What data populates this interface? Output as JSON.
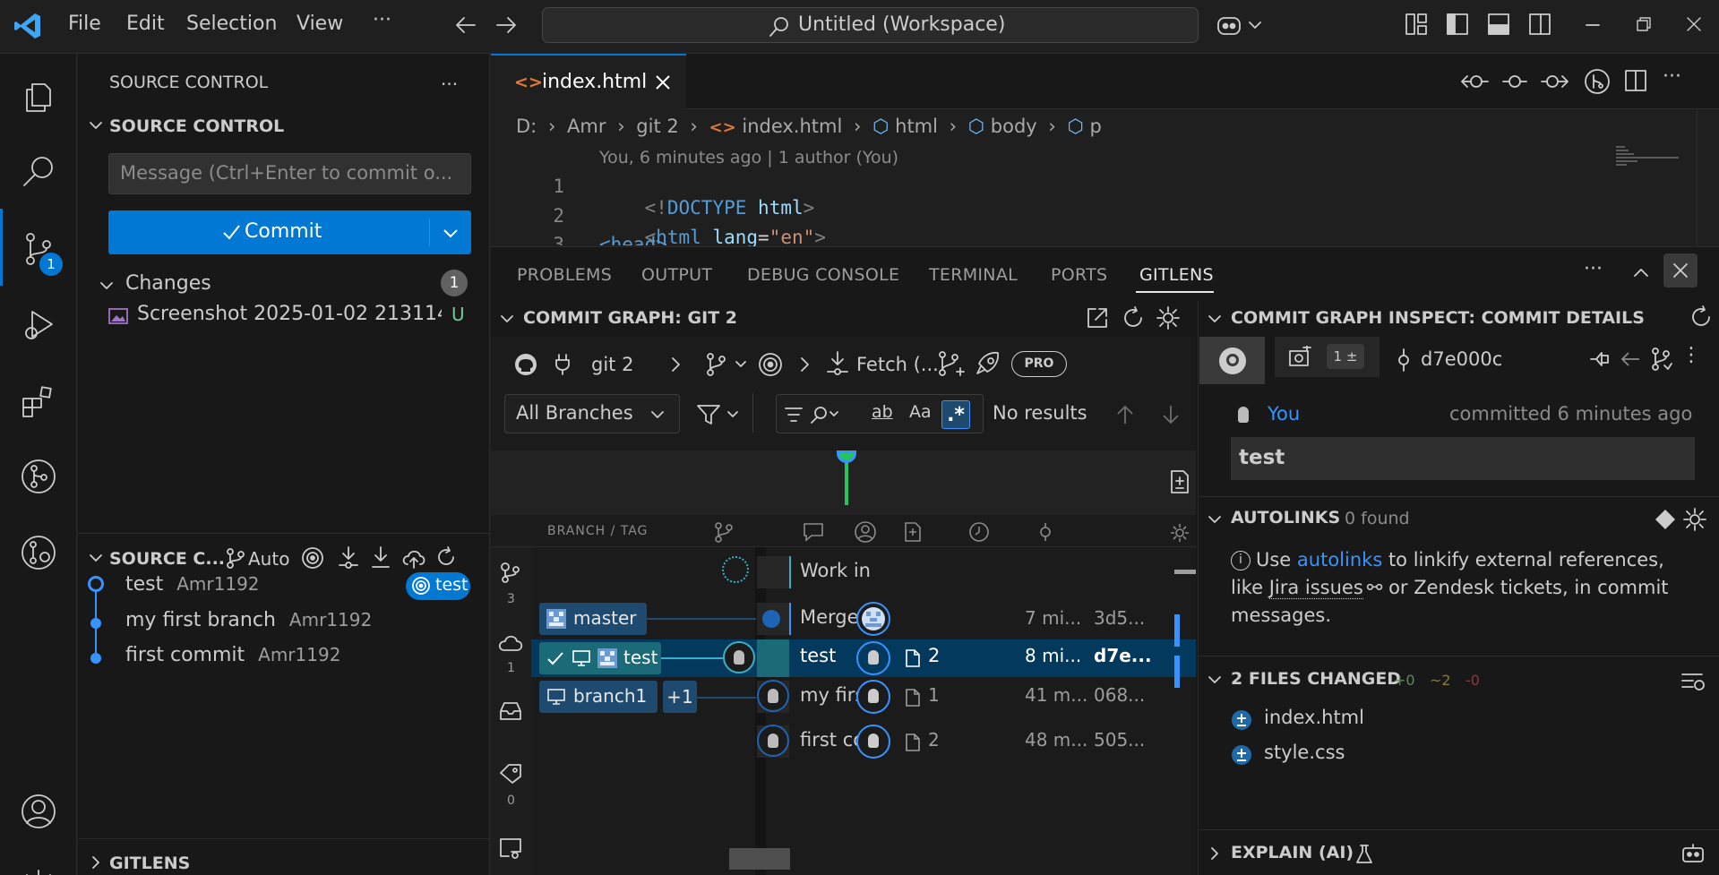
{
  "menu": {
    "file": "File",
    "edit": "Edit",
    "selection": "Selection",
    "view": "View",
    "more": "···"
  },
  "command_center": {
    "text": "Untitled (Workspace)"
  },
  "activity": {
    "scm_badge": "1"
  },
  "sidebar": {
    "title": "SOURCE CONTROL",
    "section_title": "SOURCE CONTROL",
    "commit_placeholder": "Message (Ctrl+Enter to commit o...",
    "commit_label": "Commit",
    "changes_label": "Changes",
    "changes_count": "1",
    "change_file": "Screenshot 2025-01-02 213114...",
    "change_status": "U",
    "graph_section_title": "SOURCE C...",
    "graph_auto": "Auto",
    "graph_items": [
      {
        "label": "test",
        "author": "Amr1192",
        "tag": "test"
      },
      {
        "label": "my first branch",
        "author": "Amr1192"
      },
      {
        "label": "first commit",
        "author": "Amr1192"
      }
    ],
    "gitlens_section": "GITLENS"
  },
  "editor": {
    "tab_label": "index.html",
    "breadcrumb": [
      "D:",
      "Amr",
      "git 2",
      "index.html",
      "html",
      "body",
      "p"
    ],
    "blame": "You, 6 minutes ago | 1 author (You)",
    "lines": [
      {
        "num": "1",
        "text": "<!DOCTYPE html>"
      },
      {
        "num": "2",
        "text": "<html lang=\"en\">"
      },
      {
        "num": "3",
        "text": "<head>"
      }
    ]
  },
  "panel": {
    "tabs": [
      "PROBLEMS",
      "OUTPUT",
      "DEBUG CONSOLE",
      "TERMINAL",
      "PORTS",
      "GITLENS"
    ],
    "graph_title": "COMMIT GRAPH: GIT 2",
    "repo": "git 2",
    "fetch": "Fetch (...",
    "pro": "PRO",
    "branches_select": "All Branches",
    "no_results": "No results",
    "search_ab": "ab",
    "search_aa": "Aa",
    "col_branch": "BRANCH / TAG",
    "side_counts": [
      "3",
      "1",
      "0"
    ],
    "rows": [
      {
        "message": "Work in",
        "time": "",
        "sha": "",
        "files": ""
      },
      {
        "message": "Merge p",
        "branch": "master",
        "time": "7 mi...",
        "sha": "3d5...",
        "files": ""
      },
      {
        "message": "test",
        "branch": "test",
        "time": "8 mi...",
        "sha": "d7e...",
        "files": "2"
      },
      {
        "message": "my first",
        "branch": "branch1",
        "extra": "+1",
        "time": "41 m...",
        "sha": "068...",
        "files": "1"
      },
      {
        "message": "first cor",
        "time": "48 m...",
        "sha": "505...",
        "files": "2"
      }
    ],
    "inspect": {
      "title": "COMMIT GRAPH INSPECT: COMMIT DETAILS",
      "counter": "1 ±",
      "sha": "d7e000c",
      "author": "You",
      "committed": "committed 6 minutes ago",
      "message": "test",
      "autolinks_title": "AUTOLINKS",
      "autolinks_found": "0 found",
      "autolinks_text_1": "Use ",
      "autolinks_link": "autolinks",
      "autolinks_text_2": " to linkify external references,",
      "autolinks_text_3": "like ",
      "autolinks_jira": "Jira issues",
      "autolinks_text_4": " or Zendesk tickets, in commit",
      "autolinks_text_5": "messages.",
      "files_title": "2 FILES CHANGED",
      "files_add": "+0",
      "files_mod": "~2",
      "files_del": "-0",
      "files": [
        "index.html",
        "style.css"
      ],
      "explain": "EXPLAIN (AI)"
    }
  },
  "colors": {
    "accent": "#0078d4",
    "link": "#3794ff",
    "graph_green": "#22c55e",
    "status_untracked": "#73c991"
  }
}
